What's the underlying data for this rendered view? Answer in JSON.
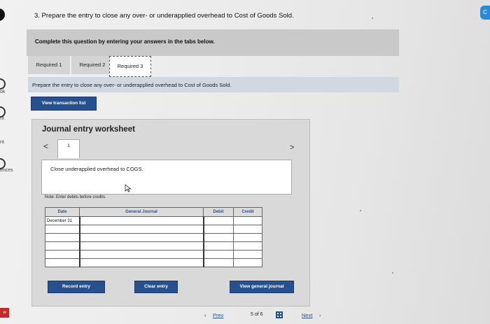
{
  "question": "3. Prepare the entry to close any over- or underapplied overhead to Cost of Goods Sold.",
  "banner": "Complete this question by entering your answers in the tabs below.",
  "tabs": [
    {
      "label": "Required 1",
      "active": false
    },
    {
      "label": "Required 2",
      "active": false
    },
    {
      "label": "Required 3",
      "active": true
    }
  ],
  "instruction": "Prepare the entry to close any over- or underapplied overhead to Cost of Goods Sold.",
  "view_transaction_label": "View transaction list",
  "worksheet": {
    "title": "Journal entry worksheet",
    "prev_glyph": "<",
    "next_glyph": ">",
    "entry_number": "1",
    "description": "Close underapplied overhead to COGS.",
    "note": "Note: Enter debits before credits.",
    "columns": [
      "Date",
      "General Journal",
      "Debit",
      "Credit"
    ],
    "date_value": "December 31",
    "record_label": "Record entry",
    "clear_label": "Clear entry",
    "view_general_label": "View general journal"
  },
  "pager": {
    "prev_label": "Prev",
    "count": "5 of 6",
    "next_label": "Next"
  },
  "side_labels": [
    "ok",
    "nt",
    "nt",
    "ences",
    "w"
  ],
  "top_right_tab": "C"
}
